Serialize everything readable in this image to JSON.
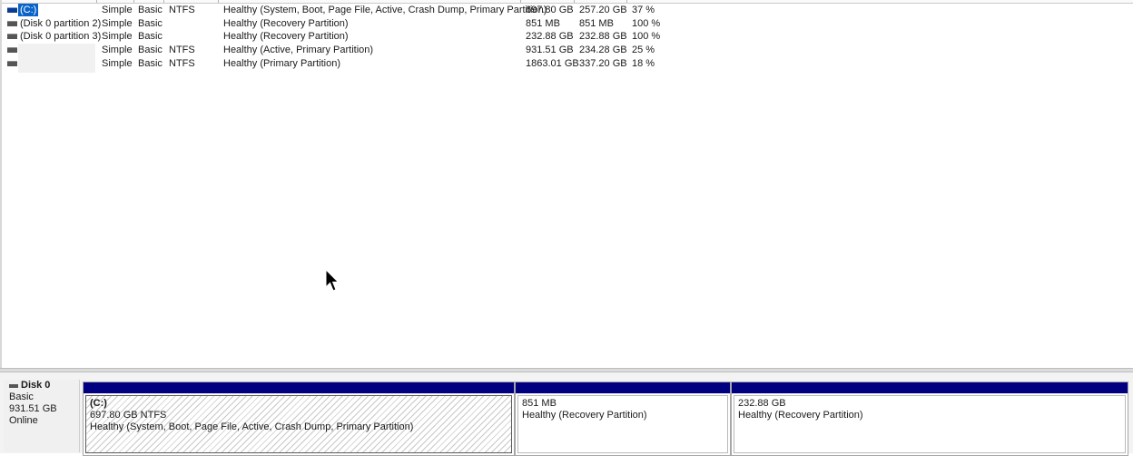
{
  "volumes": [
    {
      "name": "(C:)",
      "layout": "Simple",
      "type": "Basic",
      "fs": "NTFS",
      "status": "Healthy (System, Boot, Page File, Active, Crash Dump, Primary Partition)",
      "capacity": "697.80 GB",
      "free": "257.20 GB",
      "pct": "37 %"
    },
    {
      "name": "(Disk 0 partition 2)",
      "layout": "Simple",
      "type": "Basic",
      "fs": "",
      "status": "Healthy (Recovery Partition)",
      "capacity": "851 MB",
      "free": "851 MB",
      "pct": "100 %"
    },
    {
      "name": "(Disk 0 partition 3)",
      "layout": "Simple",
      "type": "Basic",
      "fs": "",
      "status": "Healthy (Recovery Partition)",
      "capacity": "232.88 GB",
      "free": "232.88 GB",
      "pct": "100 %"
    },
    {
      "name": "",
      "layout": "Simple",
      "type": "Basic",
      "fs": "NTFS",
      "status": "Healthy (Active, Primary Partition)",
      "capacity": "931.51 GB",
      "free": "234.28 GB",
      "pct": "25 %"
    },
    {
      "name": "",
      "layout": "Simple",
      "type": "Basic",
      "fs": "NTFS",
      "status": "Healthy (Primary Partition)",
      "capacity": "1863.01 GB",
      "free": "337.20 GB",
      "pct": "18 %"
    }
  ],
  "disk": {
    "title": "Disk 0",
    "type": "Basic",
    "size": "931.51 GB",
    "state": "Online"
  },
  "partitions": [
    {
      "name": "(C:)",
      "size": "697.80 GB NTFS",
      "status": "Healthy (System, Boot, Page File, Active, Crash Dump, Primary Partition)"
    },
    {
      "name": "",
      "size": "851 MB",
      "status": "Healthy (Recovery Partition)"
    },
    {
      "name": "",
      "size": "232.88 GB",
      "status": "Healthy (Recovery Partition)"
    }
  ],
  "colors": {
    "partition_bar": "#000080",
    "selection": "#0a64c8"
  },
  "icons": {
    "volume": "volume-icon",
    "disk": "disk-icon",
    "cursor": "mouse-pointer-icon"
  }
}
